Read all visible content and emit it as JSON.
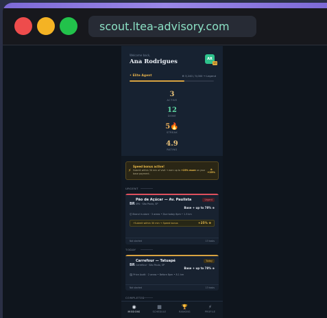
{
  "browser": {
    "url": "scout.ltea-advisory.com"
  },
  "header": {
    "welcome": "Welcome back,",
    "user_name": "Ana Rodrigues",
    "avatar_initials": "AR",
    "avatar_level": "13",
    "rank": "• Elite Agent",
    "points": "⊕ 3,240 / 5,000 → Legend",
    "xp_progress": 0.65
  },
  "stats": [
    {
      "value": "3",
      "label": "ACTIVE",
      "color": "#e8c27a"
    },
    {
      "value": "12",
      "label": "DONE",
      "color": "#5fd6a2"
    },
    {
      "value": "5🔥",
      "label": "STREAK",
      "color": "#f0b35a"
    },
    {
      "value": "4.9",
      "label": "RATING",
      "color": "#e8c27a"
    }
  ],
  "bonus": {
    "title": "Speed bonus active!",
    "desc_prefix": "Submit within 30 min of visit → earn up to",
    "desc_highlight": "+25% more",
    "desc_suffix": "on your base payment.",
    "badge_top": "⊕",
    "badge_value": "+25%"
  },
  "sections": {
    "urgent": "URGENT",
    "today": "TODAY",
    "completed": "COMPLETED"
  },
  "missions": [
    {
      "icon": "BR",
      "title": "Pão de Açúcar — Av. Paulista",
      "subtitle": "SPA · São Paulo, SP",
      "tag": "Urgent",
      "pay": "Base + up to 78% ⊕",
      "meta": "🛈 Brand in-store · 3 areas • Due today 6pm • 1.3 km",
      "promo": "⚡Submit within 30 min → Speed bonus",
      "promo_value": "+25% ⊕",
      "foot_left": "Not started",
      "foot_right": "13 tasks"
    },
    {
      "icon": "BR",
      "title": "Carrefour — Tatuapé",
      "subtitle": "Carrefour · São Paulo, SP",
      "tag": "Today",
      "pay": "Base + up to 78% ⊕",
      "meta": "🗒 Price Audit · 2 areas • Before 8pm • 8.1 km",
      "foot_left": "Not started",
      "foot_right": "13 tasks"
    }
  ],
  "nav": [
    {
      "icon": "◉",
      "label": "MISSIONS"
    },
    {
      "icon": "▦",
      "label": "SCHEDULE"
    },
    {
      "icon": "🏆",
      "label": "RANKING"
    },
    {
      "icon": "⚡",
      "label": "PROFILE"
    }
  ],
  "colors": {
    "accent": "#d9a441",
    "urgent": "#e0505e",
    "today": "#d9a441",
    "done": "#34b46f"
  }
}
